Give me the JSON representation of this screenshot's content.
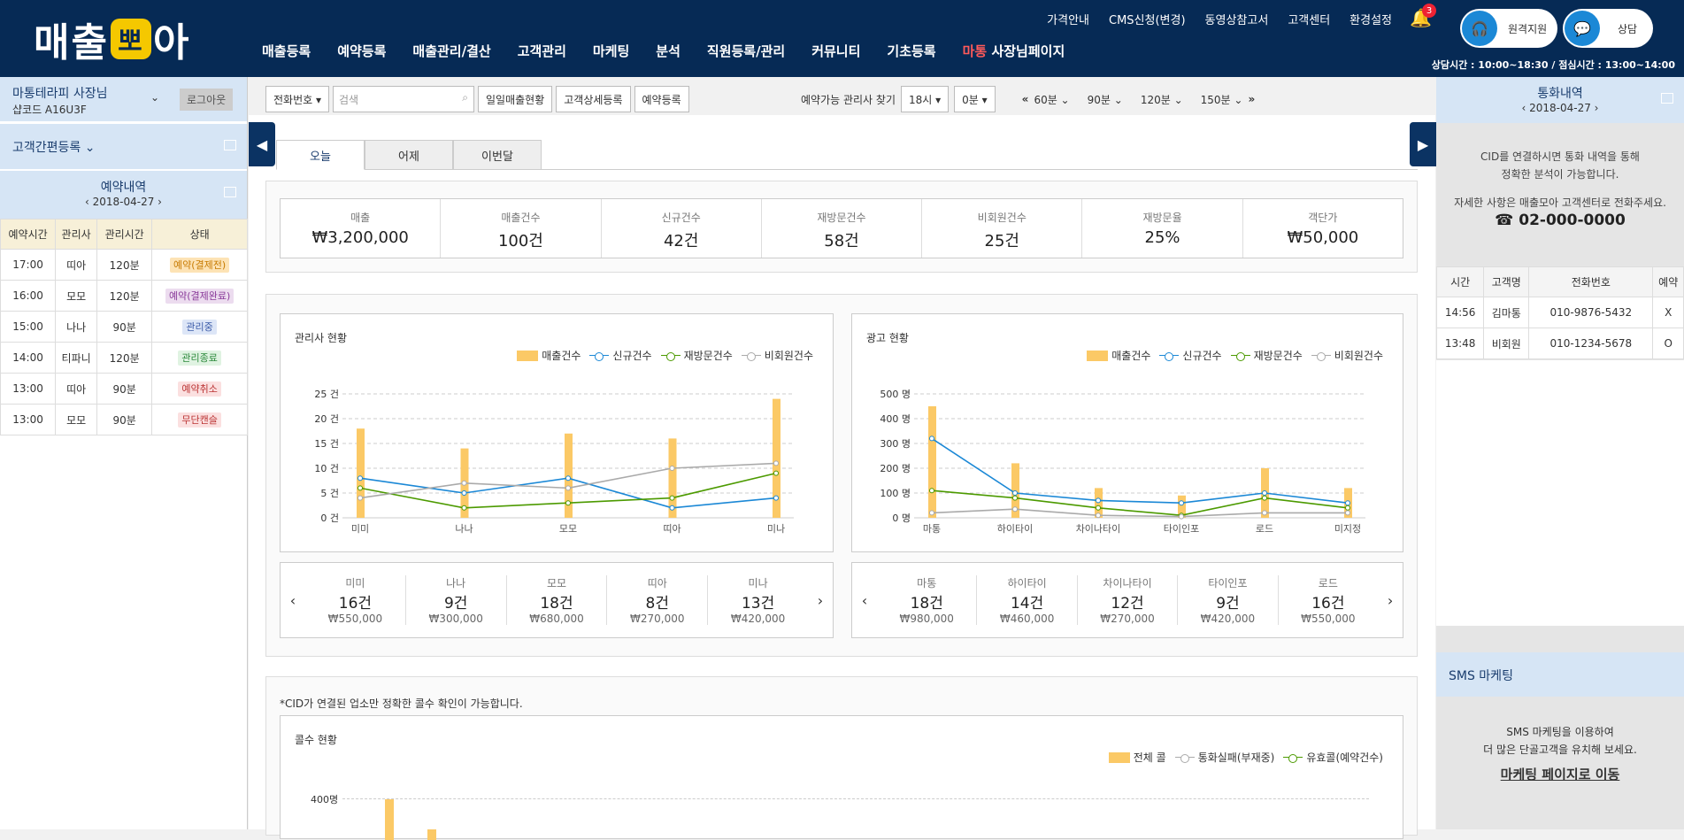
{
  "brand": {
    "logo_a": "매출",
    "logo_y": "뽀",
    "logo_b": "아"
  },
  "top_menu": [
    "가격안내",
    "CMS신청(변경)",
    "동영상참고서",
    "고객센터",
    "환경설정"
  ],
  "notif_count": "3",
  "main_nav": [
    "매출등록",
    "예약등록",
    "매출관리/결산",
    "고객관리",
    "마케팅",
    "분석",
    "직원등록/관리",
    "커뮤니티",
    "기초등록"
  ],
  "shop_nav": {
    "shop": "마통",
    "label": "사장님페이지"
  },
  "remote_label": "원격지원",
  "consult_label": "상담",
  "hours": "상담시간 : 10:00~18:30 / 점심시간 : 13:00~14:00",
  "left": {
    "owner": "마통테라피 사장님",
    "shop_code": "샵코드 A16U3F",
    "logout": "로그아웃",
    "quick_reg": "고객간편등록",
    "reserve_title": "예약내역",
    "reserve_date": "‹ 2018-04-27 ›",
    "cols": [
      "예약시간",
      "관리사",
      "관리시간",
      "상태"
    ],
    "rows": [
      [
        "17:00",
        "띠아",
        "120분",
        "예약(결제전)",
        "#fde3b5",
        "#c77a00"
      ],
      [
        "16:00",
        "모모",
        "120분",
        "예약(결제완료)",
        "#ecdcef",
        "#8a3b9a"
      ],
      [
        "15:00",
        "나나",
        "90분",
        "관리중",
        "#dde6f7",
        "#3a5aa8"
      ],
      [
        "14:00",
        "티파니",
        "120분",
        "관리종료",
        "#e0f3e2",
        "#2d8a3c"
      ],
      [
        "13:00",
        "띠아",
        "90분",
        "예약취소",
        "#fbe0e0",
        "#b33"
      ],
      [
        "13:00",
        "모모",
        "90분",
        "무단캔슬",
        "#fbe0e0",
        "#b33"
      ]
    ]
  },
  "toolbar": {
    "select": "전화번호 ▾",
    "search_ph": "검색",
    "btn1": "일일매출현황",
    "btn2": "고객상세등록",
    "btn3": "예약등록",
    "find": "예약가능 관리사 찾기",
    "hour": "18시 ▾",
    "min": "0분 ▾",
    "durs": [
      "60분 ⌄",
      "90분 ⌄",
      "120분 ⌄",
      "150분 ⌄"
    ],
    "prev": "«",
    "next": "»"
  },
  "tabs": [
    "오늘",
    "어제",
    "이번달"
  ],
  "kpis": [
    [
      "매출",
      "₩3,200,000"
    ],
    [
      "매출건수",
      "100건"
    ],
    [
      "신규건수",
      "42건"
    ],
    [
      "재방문건수",
      "58건"
    ],
    [
      "비회원건수",
      "25건"
    ],
    [
      "재방문율",
      "25%"
    ],
    [
      "객단가",
      "₩50,000"
    ]
  ],
  "legend": [
    "매출건수",
    "신규건수",
    "재방문건수",
    "비회원건수"
  ],
  "chart_data": [
    {
      "type": "bar",
      "title": "관리사 현황",
      "categories": [
        "미미",
        "나나",
        "모모",
        "띠아",
        "미나"
      ],
      "ylim": [
        0,
        25
      ],
      "yticks": [
        "0 건",
        "5 건",
        "10 건",
        "15 건",
        "20 건",
        "25 건"
      ],
      "series": [
        {
          "name": "매출건수",
          "values": [
            18,
            14,
            17,
            16,
            24
          ]
        },
        {
          "name": "신규건수",
          "values": [
            8,
            5,
            8,
            2,
            4
          ]
        },
        {
          "name": "재방문건수",
          "values": [
            6,
            2,
            3,
            4,
            9
          ]
        },
        {
          "name": "비회원건수",
          "values": [
            4,
            7,
            6,
            10,
            11
          ]
        }
      ]
    },
    {
      "type": "bar",
      "title": "광고 현황",
      "categories": [
        "마통",
        "하이타이",
        "차이나타이",
        "타이인포",
        "로드",
        "미지정"
      ],
      "ylim": [
        0,
        500
      ],
      "yticks": [
        "0 명",
        "100 명",
        "200 명",
        "300 명",
        "400 명",
        "500 명"
      ],
      "series": [
        {
          "name": "매출건수",
          "values": [
            450,
            220,
            120,
            90,
            200,
            120
          ]
        },
        {
          "name": "신규건수",
          "values": [
            320,
            100,
            70,
            60,
            100,
            60
          ]
        },
        {
          "name": "재방문건수",
          "values": [
            110,
            80,
            40,
            10,
            80,
            40
          ]
        },
        {
          "name": "비회원건수",
          "values": [
            20,
            35,
            10,
            5,
            20,
            20
          ]
        }
      ]
    }
  ],
  "mgr_strip": [
    [
      "미미",
      "16건",
      "₩550,000"
    ],
    [
      "나나",
      "9건",
      "₩300,000"
    ],
    [
      "모모",
      "18건",
      "₩680,000"
    ],
    [
      "띠아",
      "8건",
      "₩270,000"
    ],
    [
      "미나",
      "13건",
      "₩420,000"
    ]
  ],
  "ad_strip": [
    [
      "마통",
      "18건",
      "₩980,000"
    ],
    [
      "하이타이",
      "14건",
      "₩460,000"
    ],
    [
      "차이나타이",
      "12건",
      "₩270,000"
    ],
    [
      "타이인포",
      "9건",
      "₩420,000"
    ],
    [
      "로드",
      "16건",
      "₩550,000"
    ]
  ],
  "call_note": "*CID가 연결된 업소만 정확한 콜수 확인이 가능합니다.",
  "call_title": "콜수 현황",
  "call_legend": [
    "전체 콜",
    "통화실패(부재중)",
    "유효콜(예약건수)"
  ],
  "call_ytick": "400명",
  "right": {
    "title": "통화내역",
    "date": "‹ 2018-04-27 ›",
    "cid1": "CID를 연결하시면 통화 내역을 통해",
    "cid2": "정확한 분석이 가능합니다.",
    "cid3": "자세한 사항은 매출모아 고객센터로 전화주세요.",
    "tel": "☎ 02-000-0000",
    "cols": [
      "시간",
      "고객명",
      "전화번호",
      "예약"
    ],
    "rows": [
      [
        "14:56",
        "김마통",
        "010-9876-5432",
        "X"
      ],
      [
        "13:48",
        "비회원",
        "010-1234-5678",
        "O"
      ]
    ],
    "sms_title": "SMS 마케팅",
    "sms1": "SMS 마케팅을 이용하여",
    "sms2": "더 많은 단골고객을 유치해 보세요.",
    "sms_link": "마케팅 페이지로 이동"
  },
  "colors": {
    "navy": "#062a55",
    "bar": "#fbc966",
    "new": "#1b88d6",
    "revisit": "#4c9a00",
    "guest": "#aaaaaa"
  }
}
